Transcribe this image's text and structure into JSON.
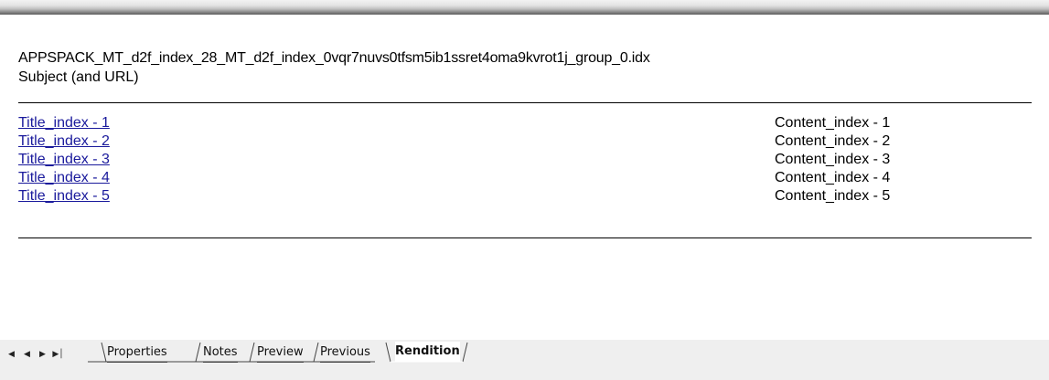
{
  "document": {
    "title": "APPSPACK_MT_d2f_index_28_MT_d2f_index_0vqr7nuvs0tfsm5ib1ssret4oma9kvrot1j_group_0.idx",
    "subtitle": "Subject (and URL)"
  },
  "rows": [
    {
      "title": "Title_index - 1",
      "content": "Content_index - 1"
    },
    {
      "title": "Title_index - 2",
      "content": "Content_index - 2"
    },
    {
      "title": "Title_index - 3",
      "content": "Content_index - 3"
    },
    {
      "title": "Title_index - 4",
      "content": "Content_index - 4"
    },
    {
      "title": "Title_index - 5",
      "content": "Content_index - 5"
    }
  ],
  "tabs": [
    {
      "label": "Properties",
      "active": false
    },
    {
      "label": "Notes",
      "active": false
    },
    {
      "label": "Preview",
      "active": false
    },
    {
      "label": "Previous",
      "active": false
    },
    {
      "label": "Rendition",
      "active": true
    }
  ],
  "nav": {
    "first_icon": "first-sheet-icon",
    "prev_icon": "prev-sheet-icon",
    "next_icon": "next-sheet-icon",
    "last_icon": "last-sheet-icon"
  },
  "colors": {
    "link": "#1a1a9c",
    "tabstrip": "#efefef"
  }
}
